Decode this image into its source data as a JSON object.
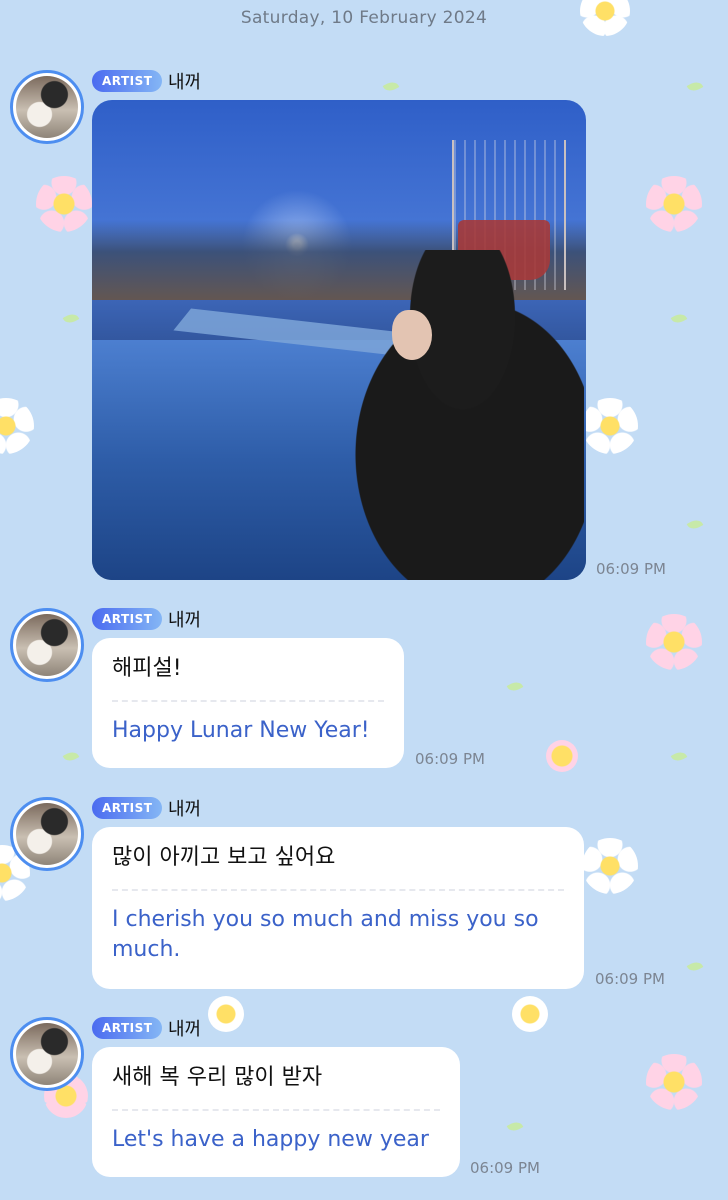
{
  "date_separator": "Saturday, 10 February 2024",
  "sender": {
    "badge": "ARTIST",
    "name": "내꺼"
  },
  "messages": [
    {
      "type": "photo",
      "photo_alt": "Person crouching by a frozen lake at dusk with lights and a ship structure",
      "time": "06:09 PM"
    },
    {
      "type": "text",
      "original": "해피설!",
      "translation": "Happy Lunar New Year!",
      "time": "06:09 PM"
    },
    {
      "type": "text",
      "original": "많이 아끼고 보고 싶어요",
      "translation": "I cherish you so much and miss you so much.",
      "time": "06:09 PM"
    },
    {
      "type": "text",
      "original": "새해 복 우리 많이 받자",
      "translation": "Let's have a happy new year",
      "time": "06:09 PM"
    }
  ],
  "colors": {
    "background": "#c3dcf5",
    "badge_gradient_start": "#4b6bf0",
    "badge_gradient_end": "#84b6f5",
    "translation_text": "#3b62c9",
    "avatar_ring": "#4d8ef0"
  },
  "icons": [
    "flower-decoration",
    "leaf-decoration"
  ]
}
